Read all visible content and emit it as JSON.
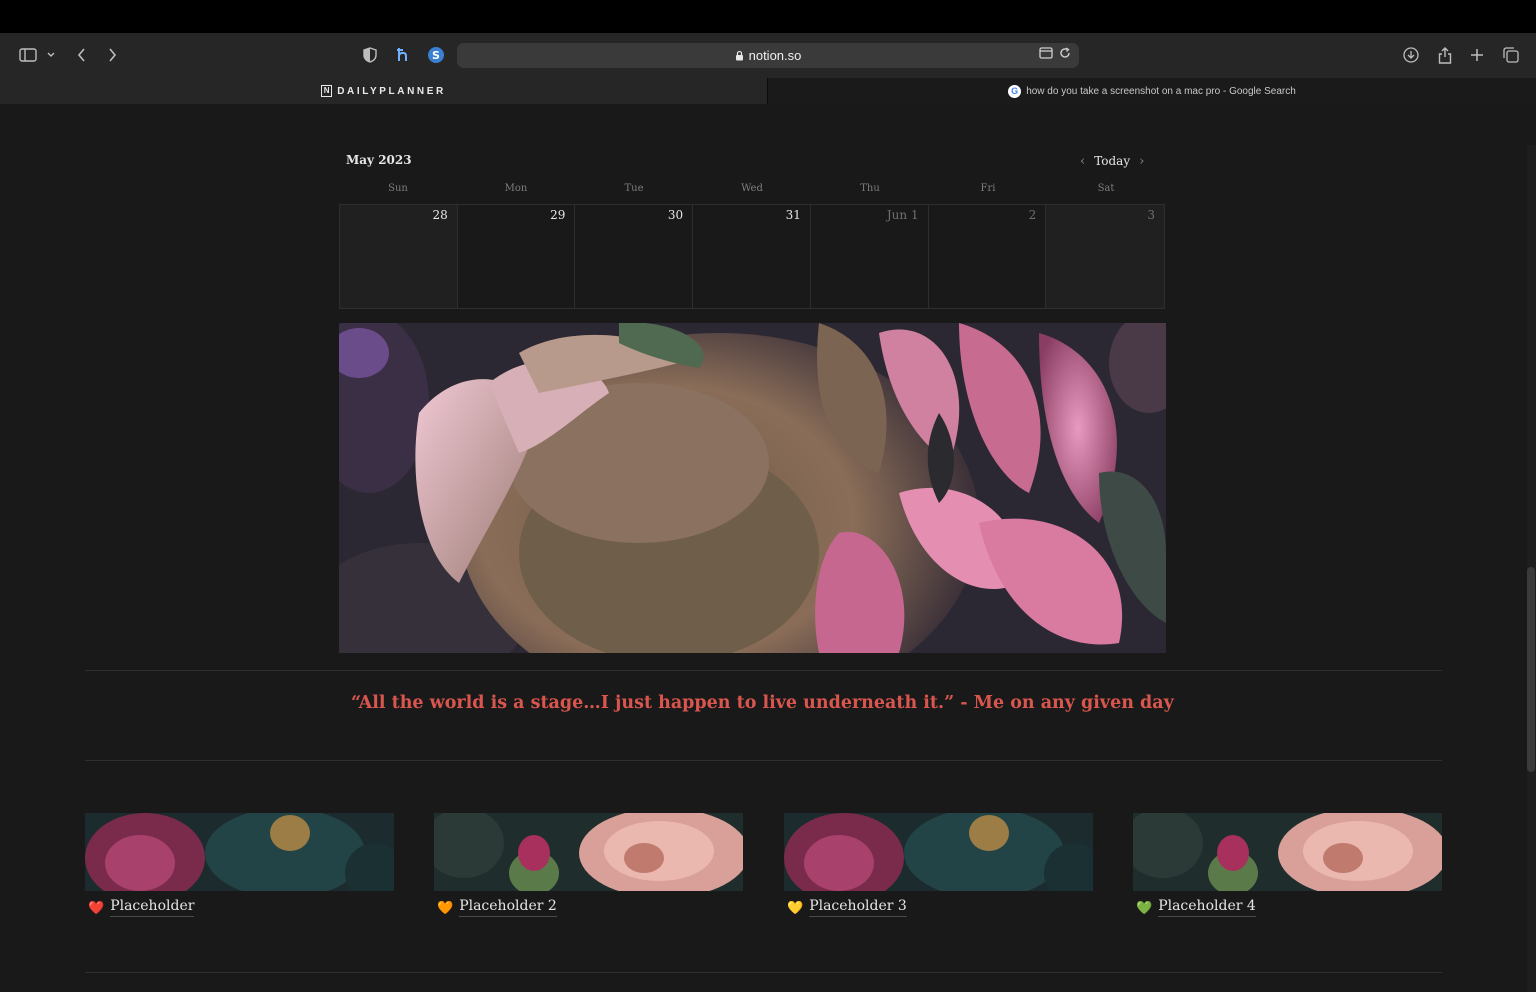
{
  "browser": {
    "url": "notion.so",
    "tabs": [
      {
        "label": "DAILYPLANNER",
        "active": true
      },
      {
        "label": "how do you take a screenshot on a mac pro - Google Search",
        "active": false
      }
    ]
  },
  "calendar": {
    "month_label": "May 2023",
    "today_label": "Today",
    "weekdays": [
      "Sun",
      "Mon",
      "Tue",
      "Wed",
      "Thu",
      "Fri",
      "Sat"
    ],
    "days": [
      "28",
      "29",
      "30",
      "31",
      "Jun 1",
      "2",
      "3"
    ]
  },
  "quote": {
    "text": "“All the world is a stage…I just happen to live underneath it.” - Me on any given day",
    "color": "#d9564e"
  },
  "gallery": {
    "cards": [
      {
        "label": "Placeholder",
        "emoji": "❤️"
      },
      {
        "label": "Placeholder 2",
        "emoji": "🧡"
      },
      {
        "label": "Placeholder 3",
        "emoji": "💛"
      },
      {
        "label": "Placeholder 4",
        "emoji": "💚"
      }
    ]
  }
}
